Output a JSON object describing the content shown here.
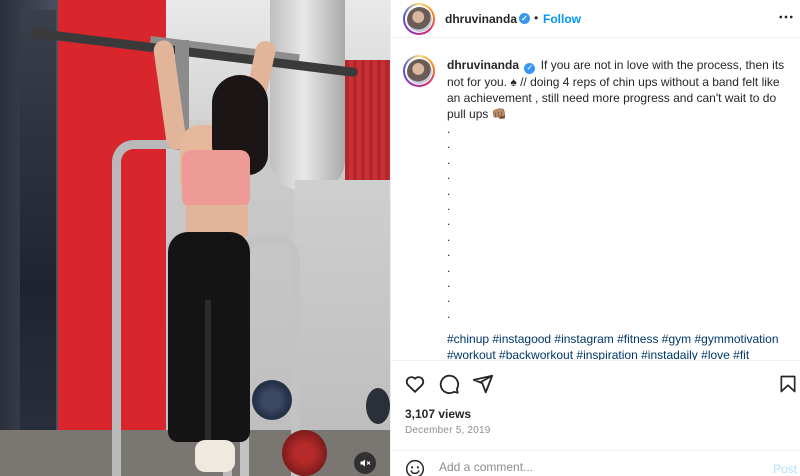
{
  "header": {
    "username": "dhruvinanda",
    "dot": "•",
    "follow_label": "Follow",
    "more_label": "•••"
  },
  "caption": {
    "username": "dhruvinanda",
    "text": "If you are not in love with the process, then its not for you. ♠ // doing 4 reps of chin ups without a band felt like an achievement , still need more progress and can't wait to do pull ups 👊🏽",
    "dots": [
      ".",
      ".",
      ".",
      ".",
      ".",
      ".",
      ".",
      ".",
      ".",
      ".",
      ".",
      ".",
      "."
    ],
    "hashtags": "#chinup #instagood #instagram #fitness #gym #gymmotivation #workout #backworkout #inspiration #instadaily #love #fit"
  },
  "stats": {
    "views": "3,107 views",
    "date": "December 5, 2019"
  },
  "comment": {
    "placeholder": "Add a comment...",
    "post_label": "Post"
  },
  "icons": {
    "like": "heart-icon",
    "comment": "comment-icon",
    "share": "share-icon",
    "save": "bookmark-icon",
    "emoji": "smiley-icon",
    "mute": "speaker-muted-icon",
    "more": "more-horizontal-icon",
    "verified": "verified-badge-icon"
  },
  "colors": {
    "accent": "#0095f6",
    "verified": "#3897f0",
    "hashtag": "#00376b",
    "muted_text": "#8e8e8e",
    "post_disabled": "#b2dffc"
  }
}
